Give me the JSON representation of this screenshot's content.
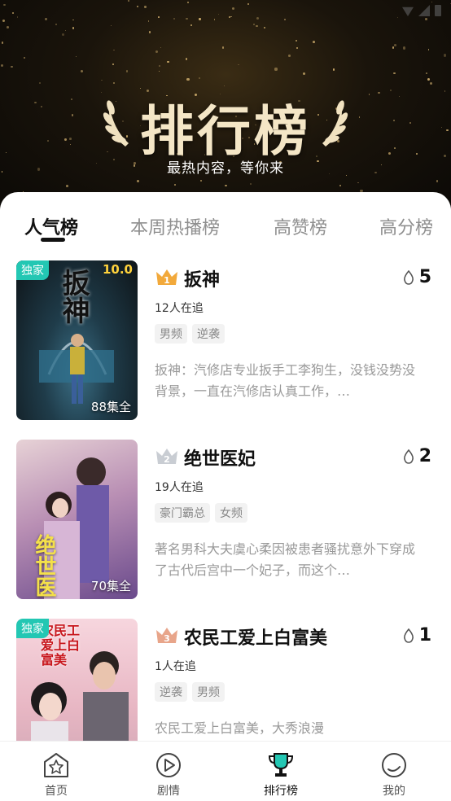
{
  "hero": {
    "title": "排行榜",
    "subtitle": "最热内容，等你来"
  },
  "tabs": [
    {
      "label": "人气榜",
      "active": true
    },
    {
      "label": "本周热播榜",
      "active": false
    },
    {
      "label": "高赞榜",
      "active": false
    },
    {
      "label": "高分榜",
      "active": false
    }
  ],
  "items": [
    {
      "rank": "1",
      "rank_icon": "crown-gold-icon",
      "title": "扳神",
      "heat": "5",
      "followers": "12人在追",
      "tags": [
        "男频",
        "逆袭"
      ],
      "description": "扳神：汽修店专业扳手工李狗生，没钱没势没背景，一直在汽修店认真工作，…",
      "badge": "独家",
      "score": "10.0",
      "episodes": "88集全",
      "poster_art_text": "扳神"
    },
    {
      "rank": "2",
      "rank_icon": "crown-silver-icon",
      "title": "绝世医妃",
      "heat": "2",
      "followers": "19人在追",
      "tags": [
        "豪门霸总",
        "女频"
      ],
      "description": "著名男科大夫虞心柔因被患者骚扰意外下穿成了古代后宫中一个妃子，而这个…",
      "badge": "",
      "score": "",
      "episodes": "70集全",
      "poster_art_text": "绝世医"
    },
    {
      "rank": "3",
      "rank_icon": "crown-bronze-icon",
      "title": "农民工爱上白富美",
      "heat": "1",
      "followers": "1人在追",
      "tags": [
        "逆袭",
        "男频"
      ],
      "description": "农民工爱上白富美，大秀浪漫",
      "badge": "独家",
      "score": "",
      "episodes": "",
      "poster_art_text": "农民工爱上白富美"
    }
  ],
  "bottom_nav": [
    {
      "label": "首页",
      "icon": "home-star-icon",
      "active": false
    },
    {
      "label": "剧情",
      "icon": "play-circle-icon",
      "active": false
    },
    {
      "label": "排行榜",
      "icon": "trophy-icon",
      "active": true
    },
    {
      "label": "我的",
      "icon": "profile-icon",
      "active": false
    }
  ],
  "colors": {
    "accent_teal": "#23c7b3",
    "gold": "#f2a93b",
    "silver": "#c9cdd3",
    "bronze": "#e8a58a"
  }
}
